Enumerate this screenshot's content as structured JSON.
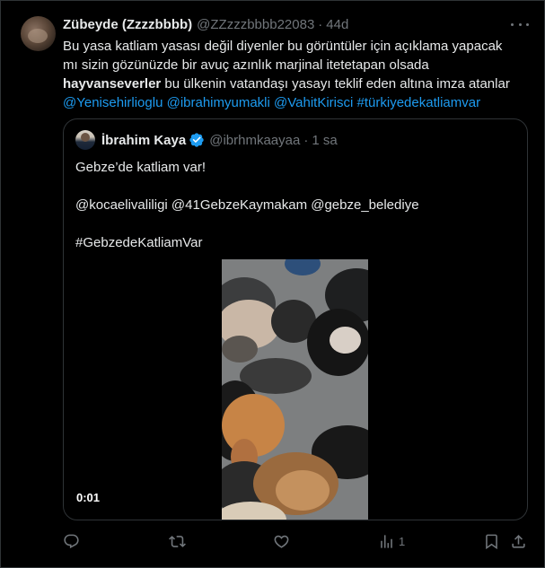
{
  "tweet": {
    "author_name": "Zübeyde (Zzzzbbbb)",
    "author_handle": "@ZZzzzbbbb22083",
    "separator": "·",
    "time": "44d",
    "text_line1": "Bu yasa katliam yasası değil diyenler bu görüntüler için açıklama yapacak",
    "text_line2": "mı sizin gözünüzde bir avuç azınlık marjinal itetetapan olsada",
    "text_bold": "hayvanseverler",
    "text_line3_rest": " bu ülkenin vatandaşı yasayı teklif eden altına imza atanlar",
    "mentions": [
      {
        "text": "@Yenisehirlioglu"
      },
      {
        "text": "@ibrahimyumakli"
      },
      {
        "text": "@VahitKirisci"
      },
      {
        "text": "#türkiyedekatliamvar"
      }
    ]
  },
  "quote": {
    "author_name": "İbrahim Kaya",
    "author_handle": "@ibrhmkaayaa",
    "separator": "·",
    "time": "1 sa",
    "line1": "Gebze’de katliam var!",
    "line2": "@kocaelivaliligi @41GebzeKaymakam @gebze_belediye",
    "line3": "#GebzedeKatliamVar",
    "video_time": "0:01"
  },
  "actions": {
    "views_count": "1"
  },
  "icons": {
    "more": "more-horizontal-icon",
    "verified": "verified-badge-icon",
    "reply": "reply-icon",
    "retweet": "retweet-icon",
    "like": "heart-icon",
    "views": "views-chart-icon",
    "bookmark": "bookmark-icon",
    "share": "share-icon"
  },
  "colors": {
    "background": "#000000",
    "text": "#e7e9ea",
    "muted": "#71767b",
    "link": "#1d9bf0",
    "border": "#2f3336"
  }
}
